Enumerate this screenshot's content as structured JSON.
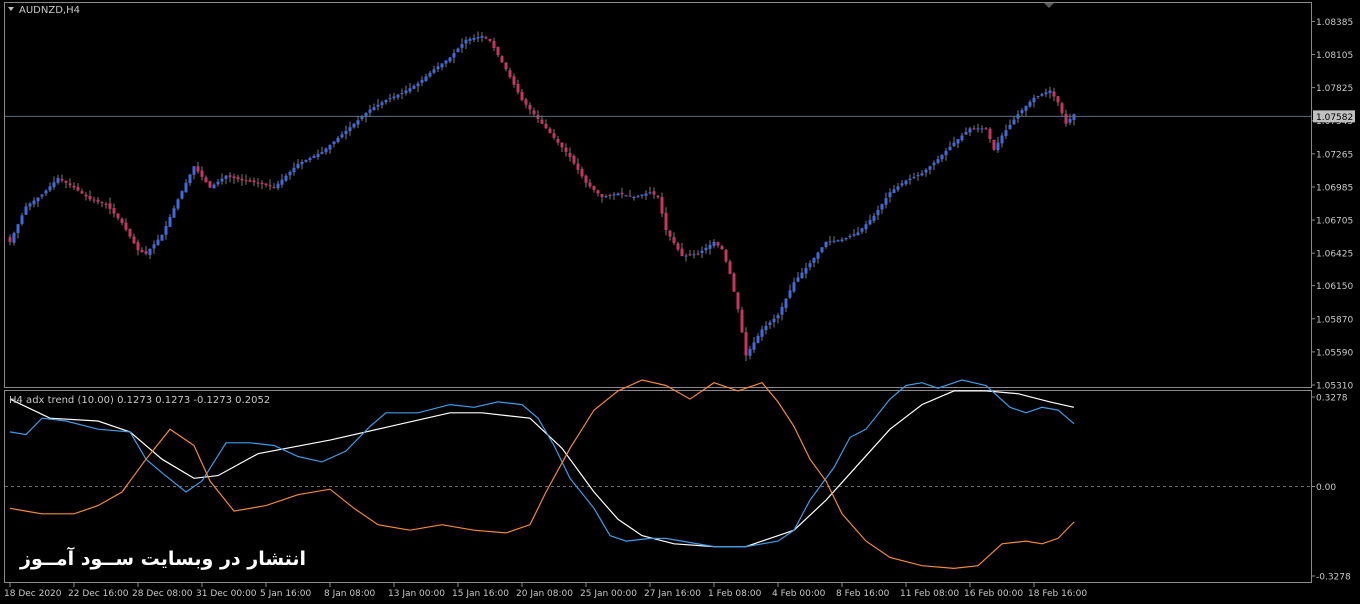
{
  "window": {
    "symbol_title": "AUDNZD,H4",
    "indicator_title": "H4 adx trend (10.00) 0.1273 0.1273 -0.1273 0.2052",
    "current_price_label": "1.07582",
    "watermark": "انتشار در وبسایت ســود آمــوز"
  },
  "colors": {
    "background": "#000000",
    "frame": "#8a8a8a",
    "bull": "#4169e1",
    "bear": "#c8365e",
    "adx_white": "#ffffff",
    "di_plus": "#3f9be5",
    "di_minus": "#f08a3c",
    "price_line": "#5a6e80",
    "label_box_bg": "#c0c0c0"
  },
  "chart_data": [
    {
      "type": "candlestick",
      "symbol": "AUDNZD",
      "timeframe": "H4",
      "ylim": [
        1.0531,
        1.0838
      ],
      "y_ticks": [
        "1.08385",
        "1.08105",
        "1.07825",
        "1.07545",
        "1.07265",
        "1.06985",
        "1.06705",
        "1.06425",
        "1.06150",
        "1.05870",
        "1.05590",
        "1.05310"
      ],
      "y_tick_values": [
        1.08385,
        1.08105,
        1.07825,
        1.07545,
        1.07265,
        1.06985,
        1.06705,
        1.06425,
        1.0615,
        1.0587,
        1.0559,
        1.0531
      ],
      "current_price": 1.07582,
      "close_path": [
        [
          0,
          1.0652
        ],
        [
          4,
          1.0682
        ],
        [
          8,
          1.0692
        ],
        [
          12,
          1.0706
        ],
        [
          16,
          1.0698
        ],
        [
          20,
          1.0688
        ],
        [
          24,
          1.0684
        ],
        [
          28,
          1.0668
        ],
        [
          32,
          1.0645
        ],
        [
          34,
          1.0642
        ],
        [
          38,
          1.0658
        ],
        [
          42,
          1.0688
        ],
        [
          46,
          1.0716
        ],
        [
          50,
          1.0698
        ],
        [
          54,
          1.0708
        ],
        [
          58,
          1.0704
        ],
        [
          62,
          1.0702
        ],
        [
          66,
          1.0698
        ],
        [
          72,
          1.0718
        ],
        [
          78,
          1.0728
        ],
        [
          82,
          1.074
        ],
        [
          86,
          1.0752
        ],
        [
          90,
          1.0764
        ],
        [
          94,
          1.0772
        ],
        [
          98,
          1.0778
        ],
        [
          102,
          1.0786
        ],
        [
          106,
          1.0798
        ],
        [
          110,
          1.0808
        ],
        [
          114,
          1.0823
        ],
        [
          118,
          1.0826
        ],
        [
          120,
          1.0822
        ],
        [
          124,
          1.0798
        ],
        [
          128,
          1.0772
        ],
        [
          132,
          1.0756
        ],
        [
          136,
          1.074
        ],
        [
          140,
          1.0724
        ],
        [
          144,
          1.0702
        ],
        [
          148,
          1.069
        ],
        [
          152,
          1.0693
        ],
        [
          156,
          1.069
        ],
        [
          160,
          1.0694
        ],
        [
          162,
          1.069
        ],
        [
          164,
          1.0662
        ],
        [
          168,
          1.064
        ],
        [
          172,
          1.0642
        ],
        [
          176,
          1.0652
        ],
        [
          178,
          1.0646
        ],
        [
          180,
          1.0625
        ],
        [
          182,
          1.0595
        ],
        [
          184,
          1.0556
        ],
        [
          188,
          1.0578
        ],
        [
          192,
          1.059
        ],
        [
          196,
          1.0618
        ],
        [
          200,
          1.0634
        ],
        [
          204,
          1.0652
        ],
        [
          208,
          1.0654
        ],
        [
          212,
          1.066
        ],
        [
          216,
          1.0674
        ],
        [
          220,
          1.0694
        ],
        [
          224,
          1.0704
        ],
        [
          228,
          1.071
        ],
        [
          232,
          1.0722
        ],
        [
          236,
          1.0736
        ],
        [
          240,
          1.0748
        ],
        [
          244,
          1.0748
        ],
        [
          246,
          1.073
        ],
        [
          248,
          1.0742
        ],
        [
          252,
          1.076
        ],
        [
          256,
          1.0774
        ],
        [
          260,
          1.078
        ],
        [
          262,
          1.077
        ],
        [
          264,
          1.0752
        ],
        [
          266,
          1.076
        ]
      ]
    },
    {
      "type": "line",
      "title": "H4 adx trend (10.00) 0.1273 0.1273 -0.1273 0.2052",
      "ylim": [
        -0.3278,
        0.3278
      ],
      "y_ticks": [
        "0.3278",
        "0.00",
        "-0.3278"
      ],
      "zero_line": 0.0,
      "series": [
        {
          "color": "#ffffff",
          "points": [
            [
              0,
              0.32
            ],
            [
              10,
              0.25
            ],
            [
              22,
              0.24
            ],
            [
              30,
              0.2
            ],
            [
              38,
              0.1
            ],
            [
              46,
              0.03
            ],
            [
              52,
              0.04
            ],
            [
              62,
              0.12
            ],
            [
              80,
              0.17
            ],
            [
              95,
              0.22
            ],
            [
              110,
              0.27
            ],
            [
              118,
              0.27
            ],
            [
              130,
              0.25
            ],
            [
              138,
              0.14
            ],
            [
              146,
              -0.02
            ],
            [
              152,
              -0.12
            ],
            [
              158,
              -0.18
            ],
            [
              166,
              -0.21
            ],
            [
              176,
              -0.22
            ],
            [
              184,
              -0.22
            ],
            [
              196,
              -0.16
            ],
            [
              204,
              -0.05
            ],
            [
              212,
              0.08
            ],
            [
              220,
              0.21
            ],
            [
              228,
              0.3
            ],
            [
              236,
              0.35
            ],
            [
              244,
              0.35
            ],
            [
              252,
              0.34
            ],
            [
              260,
              0.31
            ],
            [
              266,
              0.29
            ]
          ]
        },
        {
          "color": "#3f9be5",
          "points": [
            [
              0,
              0.2
            ],
            [
              4,
              0.19
            ],
            [
              8,
              0.25
            ],
            [
              14,
              0.24
            ],
            [
              22,
              0.21
            ],
            [
              30,
              0.2
            ],
            [
              34,
              0.1
            ],
            [
              38,
              0.05
            ],
            [
              44,
              -0.02
            ],
            [
              48,
              0.02
            ],
            [
              54,
              0.16
            ],
            [
              60,
              0.16
            ],
            [
              66,
              0.15
            ],
            [
              72,
              0.11
            ],
            [
              78,
              0.09
            ],
            [
              84,
              0.13
            ],
            [
              90,
              0.22
            ],
            [
              94,
              0.27
            ],
            [
              102,
              0.27
            ],
            [
              110,
              0.3
            ],
            [
              116,
              0.29
            ],
            [
              122,
              0.31
            ],
            [
              128,
              0.3
            ],
            [
              132,
              0.25
            ],
            [
              136,
              0.15
            ],
            [
              140,
              0.03
            ],
            [
              146,
              -0.08
            ],
            [
              150,
              -0.18
            ],
            [
              154,
              -0.2
            ],
            [
              160,
              -0.19
            ],
            [
              164,
              -0.19
            ],
            [
              168,
              -0.2
            ],
            [
              176,
              -0.22
            ],
            [
              184,
              -0.22
            ],
            [
              192,
              -0.2
            ],
            [
              196,
              -0.16
            ],
            [
              200,
              -0.05
            ],
            [
              206,
              0.07
            ],
            [
              210,
              0.18
            ],
            [
              214,
              0.21
            ],
            [
              220,
              0.32
            ],
            [
              224,
              0.37
            ],
            [
              228,
              0.38
            ],
            [
              232,
              0.36
            ],
            [
              238,
              0.39
            ],
            [
              244,
              0.37
            ],
            [
              250,
              0.29
            ],
            [
              254,
              0.27
            ],
            [
              258,
              0.29
            ],
            [
              262,
              0.28
            ],
            [
              266,
              0.23
            ]
          ]
        },
        {
          "color": "#f08a3c",
          "points": [
            [
              0,
              -0.08
            ],
            [
              4,
              -0.09
            ],
            [
              8,
              -0.1
            ],
            [
              16,
              -0.1
            ],
            [
              22,
              -0.07
            ],
            [
              28,
              -0.02
            ],
            [
              34,
              0.1
            ],
            [
              40,
              0.21
            ],
            [
              46,
              0.15
            ],
            [
              50,
              0.02
            ],
            [
              56,
              -0.09
            ],
            [
              64,
              -0.07
            ],
            [
              72,
              -0.03
            ],
            [
              80,
              -0.01
            ],
            [
              86,
              -0.08
            ],
            [
              92,
              -0.14
            ],
            [
              100,
              -0.16
            ],
            [
              108,
              -0.14
            ],
            [
              116,
              -0.16
            ],
            [
              124,
              -0.17
            ],
            [
              130,
              -0.14
            ],
            [
              134,
              -0.02
            ],
            [
              140,
              0.14
            ],
            [
              146,
              0.28
            ],
            [
              152,
              0.35
            ],
            [
              158,
              0.39
            ],
            [
              164,
              0.37
            ],
            [
              170,
              0.32
            ],
            [
              176,
              0.38
            ],
            [
              182,
              0.35
            ],
            [
              188,
              0.38
            ],
            [
              192,
              0.31
            ],
            [
              196,
              0.22
            ],
            [
              200,
              0.1
            ],
            [
              204,
              0.02
            ],
            [
              208,
              -0.1
            ],
            [
              214,
              -0.2
            ],
            [
              220,
              -0.26
            ],
            [
              228,
              -0.29
            ],
            [
              236,
              -0.3
            ],
            [
              242,
              -0.29
            ],
            [
              248,
              -0.21
            ],
            [
              254,
              -0.2
            ],
            [
              258,
              -0.21
            ],
            [
              262,
              -0.19
            ],
            [
              266,
              -0.13
            ]
          ]
        }
      ]
    }
  ],
  "x_axis": {
    "labels": [
      {
        "text": "18 Dec 2020",
        "bar": 0
      },
      {
        "text": "22 Dec 16:00",
        "bar": 16
      },
      {
        "text": "28 Dec 08:00",
        "bar": 32
      },
      {
        "text": "31 Dec 00:00",
        "bar": 48
      },
      {
        "text": "5 Jan 16:00",
        "bar": 64
      },
      {
        "text": "8 Jan 08:00",
        "bar": 80
      },
      {
        "text": "13 Jan 00:00",
        "bar": 96
      },
      {
        "text": "15 Jan 16:00",
        "bar": 112
      },
      {
        "text": "20 Jan 08:00",
        "bar": 128
      },
      {
        "text": "25 Jan 00:00",
        "bar": 144
      },
      {
        "text": "27 Jan 16:00",
        "bar": 160
      },
      {
        "text": "1 Feb 08:00",
        "bar": 176
      },
      {
        "text": "4 Feb 00:00",
        "bar": 192
      },
      {
        "text": "8 Feb 16:00",
        "bar": 208
      },
      {
        "text": "11 Feb 08:00",
        "bar": 224
      },
      {
        "text": "16 Feb 00:00",
        "bar": 240
      },
      {
        "text": "18 Feb 16:00",
        "bar": 256
      }
    ]
  }
}
